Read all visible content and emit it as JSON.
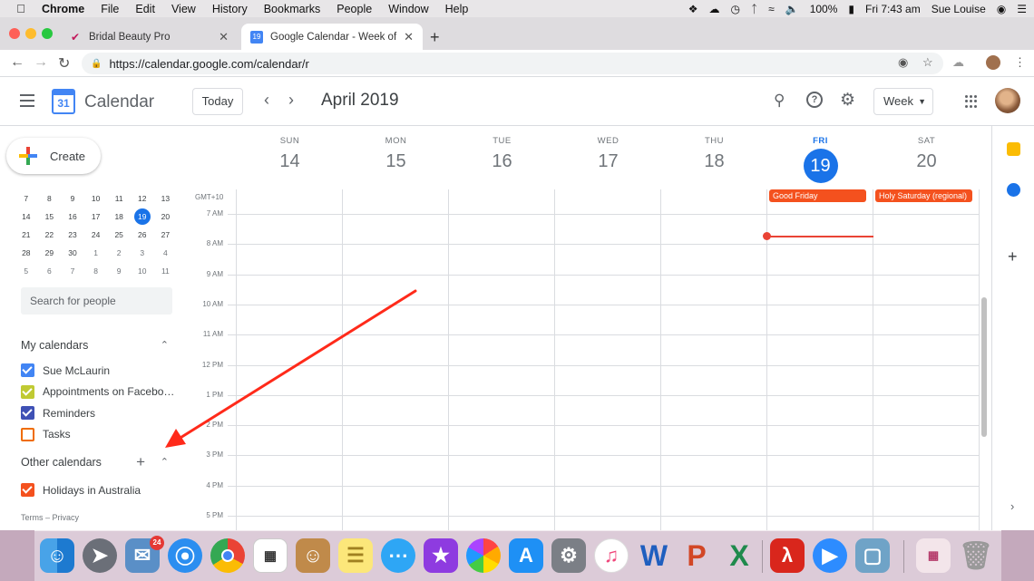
{
  "menubar": {
    "items": [
      "Chrome",
      "File",
      "Edit",
      "View",
      "History",
      "Bookmarks",
      "People",
      "Window",
      "Help"
    ],
    "battery": "100%",
    "clock": "Fri 7:43 am",
    "user": "Sue Louise"
  },
  "browser": {
    "tabs": [
      {
        "title": "Bridal Beauty Pro"
      },
      {
        "title": "Google Calendar - Week of Apr"
      }
    ],
    "url": "https://calendar.google.com/calendar/r",
    "active_tab_favicon_text": "19"
  },
  "calendar": {
    "logo_number": "31",
    "app_title": "Calendar",
    "today_label": "Today",
    "month_title": "April 2019",
    "view_label": "Week",
    "create_label": "Create",
    "mini_calendar": {
      "rows": [
        [
          "7",
          "8",
          "9",
          "10",
          "11",
          "12",
          "13"
        ],
        [
          "14",
          "15",
          "16",
          "17",
          "18",
          "19",
          "20"
        ],
        [
          "21",
          "22",
          "23",
          "24",
          "25",
          "26",
          "27"
        ],
        [
          "28",
          "29",
          "30",
          "1",
          "2",
          "3",
          "4"
        ],
        [
          "5",
          "6",
          "7",
          "8",
          "9",
          "10",
          "11"
        ]
      ],
      "today": "19"
    },
    "search_people_placeholder": "Search for people",
    "my_calendars_label": "My calendars",
    "my_calendars": [
      {
        "name": "Sue McLaurin",
        "color": "#4285f4",
        "checked": true
      },
      {
        "name": "Appointments on Facebook",
        "color": "#c0ca33",
        "checked": true
      },
      {
        "name": "Reminders",
        "color": "#3f51b5",
        "checked": true
      },
      {
        "name": "Tasks",
        "color": "#ef6c00",
        "checked": false
      }
    ],
    "other_calendars_label": "Other calendars",
    "other_calendars": [
      {
        "name": "Holidays in Australia",
        "color": "#f4511e",
        "checked": true
      }
    ],
    "footer": "Terms – Privacy",
    "timezone": "GMT+10",
    "days": [
      {
        "name": "SUN",
        "date": "14"
      },
      {
        "name": "MON",
        "date": "15"
      },
      {
        "name": "TUE",
        "date": "16"
      },
      {
        "name": "WED",
        "date": "17"
      },
      {
        "name": "THU",
        "date": "18"
      },
      {
        "name": "FRI",
        "date": "19",
        "current": true
      },
      {
        "name": "SAT",
        "date": "20"
      }
    ],
    "all_day_events": [
      {
        "title": "Good Friday",
        "day_index": 5
      },
      {
        "title": "Holy Saturday (regional)",
        "day_index": 6
      }
    ],
    "hours": [
      "7 AM",
      "8 AM",
      "9 AM",
      "10 AM",
      "11 AM",
      "12 PM",
      "1 PM",
      "2 PM",
      "3 PM",
      "4 PM",
      "5 PM"
    ],
    "current_time_day_index": 5
  },
  "colors": {
    "accent": "#1a73e8",
    "event": "#f4511e",
    "now_line": "#ea4335",
    "annotation_arrow": "#ff2a1a"
  }
}
